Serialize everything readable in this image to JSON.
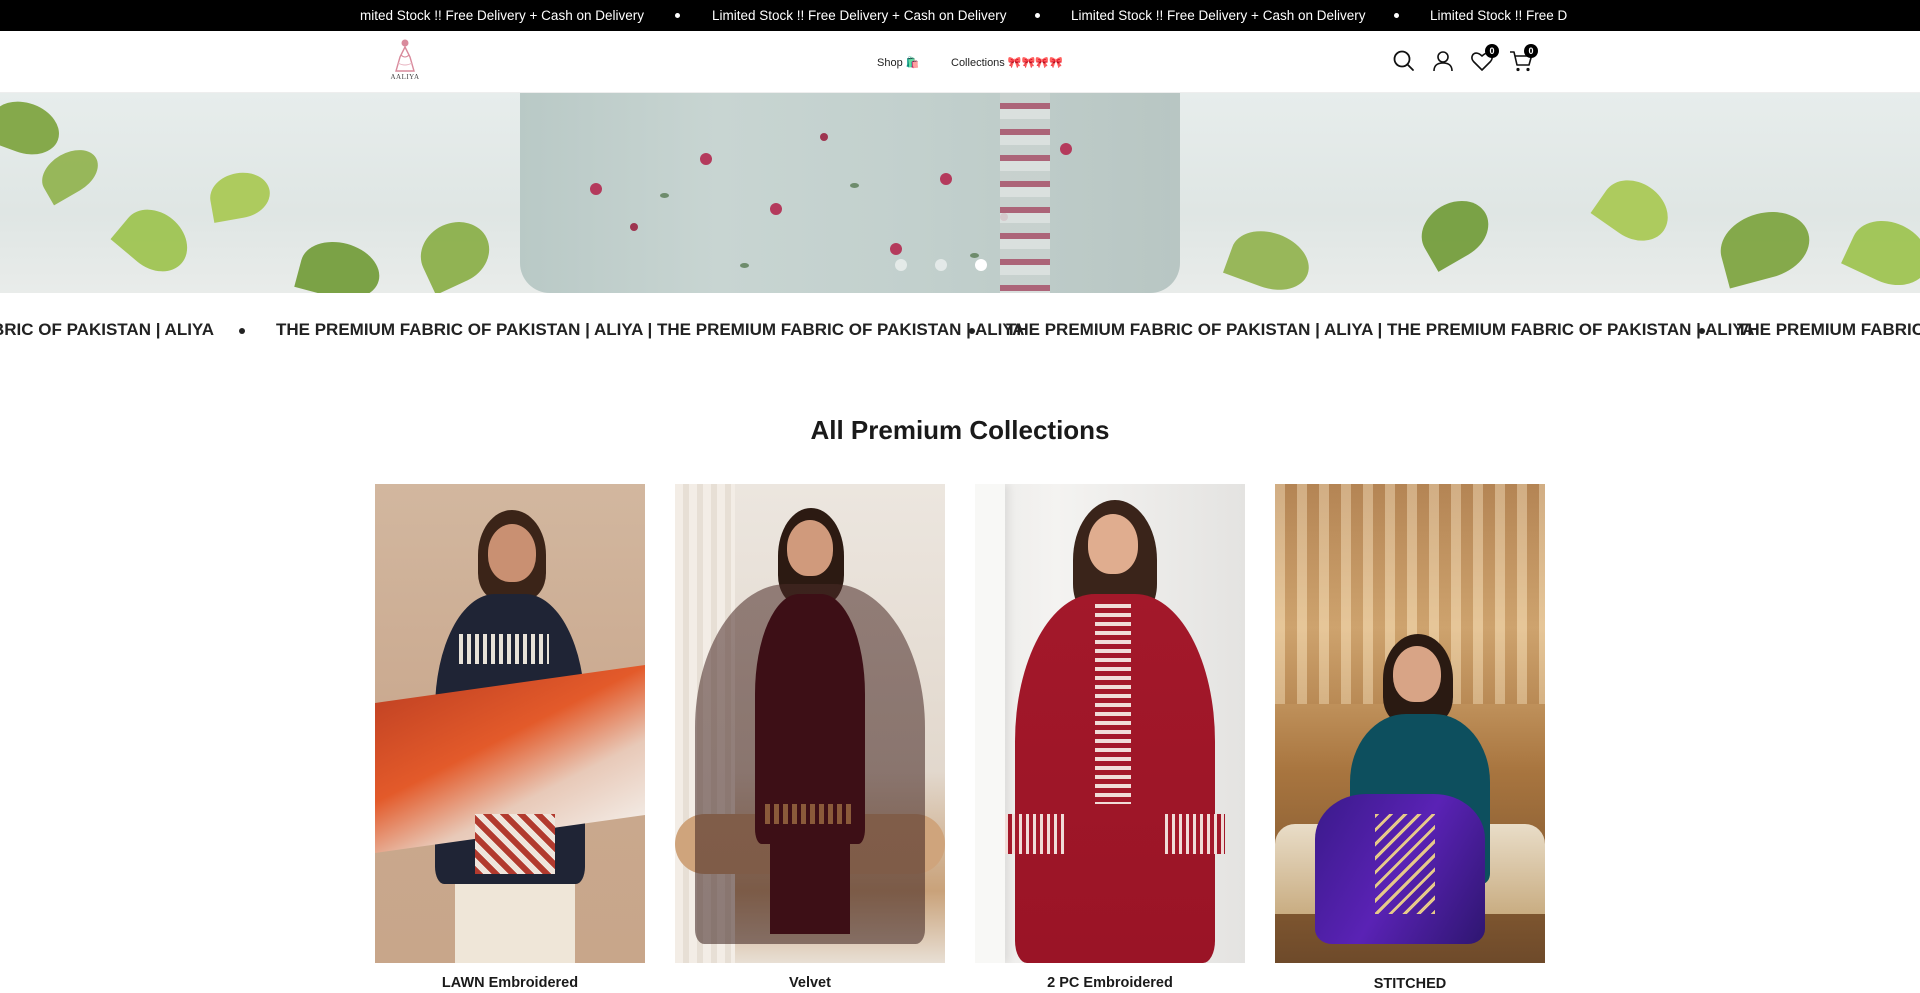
{
  "announcement": {
    "items": [
      "mited Stock !! Free Delivery + Cash on Delivery",
      "Limited Stock !! Free Delivery + Cash on Delivery",
      "Limited Stock !! Free Delivery + Cash on Delivery",
      "Limited Stock !! Free D"
    ]
  },
  "header": {
    "logo_text": "AALIYA",
    "nav": [
      {
        "label": "Shop 🛍️"
      },
      {
        "label": "Collections 🎀🎀🎀🎀"
      }
    ],
    "wishlist_count": "0",
    "cart_count": "0"
  },
  "hero": {
    "slide_count": 3,
    "active_slide": 3
  },
  "marquee": {
    "items": [
      "BRIC OF PAKISTAN | ALIYA",
      "THE PREMIUM FABRIC OF PAKISTAN | ALIYA | THE PREMIUM FABRIC OF PAKISTAN | ALIYA",
      "THE PREMIUM FABRIC OF PAKISTAN | ALIYA | THE PREMIUM FABRIC OF PAKISTAN | ALIYA",
      "THE PREMIUM FABRIC OF"
    ]
  },
  "collections": {
    "title": "All Premium Collections",
    "items": [
      {
        "label": "LAWN Embroidered"
      },
      {
        "label": "Velvet"
      },
      {
        "label": "2 PC Embroidered"
      },
      {
        "label": "STITCHED"
      }
    ]
  },
  "colors": {
    "announcement_bg": "#000000",
    "text_dark": "#1a1a1a",
    "accent_pink": "#b43a5c"
  },
  "icons": [
    "search-icon",
    "account-icon",
    "wishlist-heart-icon",
    "cart-icon"
  ]
}
